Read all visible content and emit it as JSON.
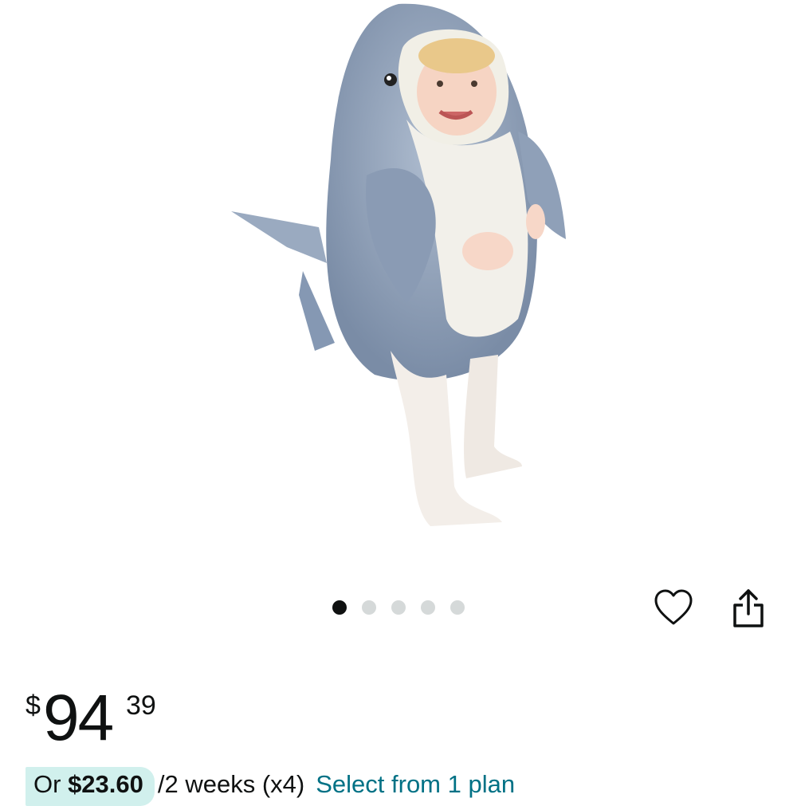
{
  "product_image": {
    "alt_icon": "shark-costume-photo"
  },
  "carousel": {
    "total": 5,
    "active_index": 0
  },
  "actions": {
    "favorite_icon": "heart-icon",
    "share_icon": "share-icon"
  },
  "price": {
    "symbol": "$",
    "whole": "94",
    "fraction": "39"
  },
  "installment": {
    "prefix": "Or",
    "amount": "$23.60",
    "period": "/2 weeks (x4)",
    "link": "Select from 1 plan"
  },
  "colors": {
    "link": "#007185",
    "installment_highlight": "#d1f0ed",
    "text": "#0f1111"
  }
}
